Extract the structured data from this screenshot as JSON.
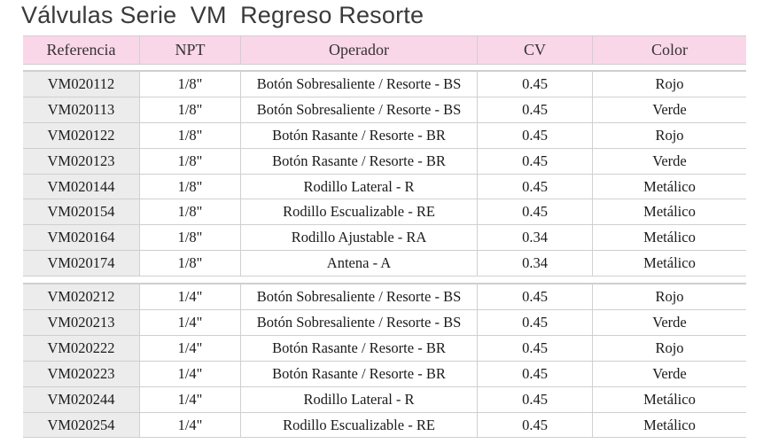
{
  "title": "Válvulas Serie  VM  Regreso Resorte",
  "columns": [
    "Referencia",
    "NPT",
    "Operador",
    "CV",
    "Color"
  ],
  "group1": [
    [
      "VM020112",
      "1/8\"",
      "Botón Sobresaliente / Resorte - BS",
      "0.45",
      "Rojo"
    ],
    [
      "VM020113",
      "1/8\"",
      "Botón Sobresaliente / Resorte - BS",
      "0.45",
      "Verde"
    ],
    [
      "VM020122",
      "1/8\"",
      "Botón Rasante / Resorte - BR",
      "0.45",
      "Rojo"
    ],
    [
      "VM020123",
      "1/8\"",
      "Botón Rasante / Resorte - BR",
      "0.45",
      "Verde"
    ],
    [
      "VM020144",
      "1/8\"",
      "Rodillo Lateral - R",
      "0.45",
      "Metálico"
    ],
    [
      "VM020154",
      "1/8\"",
      "Rodillo Escualizable - RE",
      "0.45",
      "Metálico"
    ],
    [
      "VM020164",
      "1/8\"",
      "Rodillo Ajustable - RA",
      "0.34",
      "Metálico"
    ],
    [
      "VM020174",
      "1/8\"",
      "Antena - A",
      "0.34",
      "Metálico"
    ]
  ],
  "group2": [
    [
      "VM020212",
      "1/4\"",
      "Botón Sobresaliente / Resorte - BS",
      "0.45",
      "Rojo"
    ],
    [
      "VM020213",
      "1/4\"",
      "Botón Sobresaliente / Resorte - BS",
      "0.45",
      "Verde"
    ],
    [
      "VM020222",
      "1/4\"",
      "Botón Rasante / Resorte - BR",
      "0.45",
      "Rojo"
    ],
    [
      "VM020223",
      "1/4\"",
      "Botón Rasante / Resorte - BR",
      "0.45",
      "Verde"
    ],
    [
      "VM020244",
      "1/4\"",
      "Rodillo Lateral - R",
      "0.45",
      "Metálico"
    ],
    [
      "VM020254",
      "1/4\"",
      "Rodillo Escualizable - RE",
      "0.45",
      "Metálico"
    ]
  ]
}
